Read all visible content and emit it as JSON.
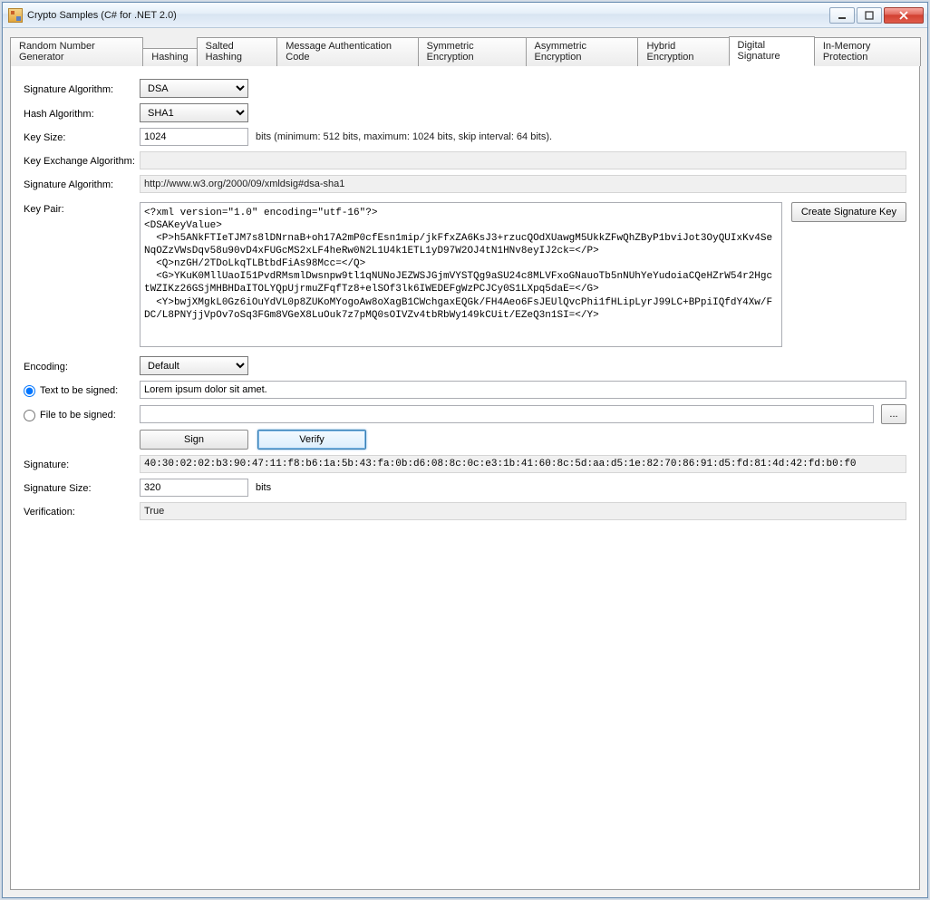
{
  "window": {
    "title": "Crypto Samples (C# for .NET 2.0)"
  },
  "tabs": [
    {
      "label": "Random Number Generator"
    },
    {
      "label": "Hashing"
    },
    {
      "label": "Salted Hashing"
    },
    {
      "label": "Message Authentication Code"
    },
    {
      "label": "Symmetric Encryption"
    },
    {
      "label": "Asymmetric Encryption"
    },
    {
      "label": "Hybrid Encryption"
    },
    {
      "label": "Digital Signature"
    },
    {
      "label": "In-Memory Protection"
    }
  ],
  "labels": {
    "sig_algo": "Signature Algorithm:",
    "hash_algo": "Hash Algorithm:",
    "key_size": "Key Size:",
    "key_exchange": "Key Exchange Algorithm:",
    "sig_algo2": "Signature Algorithm:",
    "key_pair": "Key Pair:",
    "encoding": "Encoding:",
    "text_to_sign": "Text to be signed:",
    "file_to_sign": "File to be signed:",
    "signature": "Signature:",
    "signature_size": "Signature Size:",
    "verification": "Verification:"
  },
  "values": {
    "sig_algo_selected": "DSA",
    "hash_algo_selected": "SHA1",
    "key_size": "1024",
    "key_size_hint": "bits (minimum: 512 bits, maximum: 1024 bits, skip interval: 64 bits).",
    "key_exchange": "",
    "sig_algo_url": "http://www.w3.org/2000/09/xmldsig#dsa-sha1",
    "key_pair_xml": "<?xml version=\"1.0\" encoding=\"utf-16\"?>\n<DSAKeyValue>\n  <P>h5ANkFTIeTJM7s8lDNrnaB+oh17A2mP0cfEsn1mip/jkFfxZA6KsJ3+rzucQOdXUawgM5UkkZFwQhZByP1bviJot3OyQUIxKv4SeNqOZzVWsDqv58u90vD4xFUGcMS2xLF4heRw0N2L1U4k1ETL1yD97W2OJ4tN1HNv8eyIJ2ck=</P>\n  <Q>nzGH/2TDoLkqTLBtbdFiAs98Mcc=</Q>\n  <G>YKuK0MllUaoI51PvdRMsmlDwsnpw9tl1qNUNoJEZWSJGjmVYSTQg9aSU24c8MLVFxoGNauoTb5nNUhYeYudoiaCQeHZrW54r2HgctWZIKz26GSjMHBHDaITOLYQpUjrmuZFqfTz8+elSOf3lk6IWEDEFgWzPCJCy0S1LXpq5daE=</G>\n  <Y>bwjXMgkL0Gz6iOuYdVL0p8ZUKoMYogoAw8oXagB1CWchgaxEQGk/FH4Aeo6FsJEUlQvcPhi1fHLipLyrJ99LC+BPpiIQfdY4Xw/FDC/L8PNYjjVpOv7oSq3FGm8VGeX8LuOuk7z7pMQ0sOIVZv4tbRbWy149kCUit/EZeQ3n1SI=</Y>",
    "encoding_selected": "Default",
    "text_value": "Lorem ipsum dolor sit amet.",
    "file_value": "",
    "signature": "40:30:02:02:b3:90:47:11:f8:b6:1a:5b:43:fa:0b:d6:08:8c:0c:e3:1b:41:60:8c:5d:aa:d5:1e:82:70:86:91:d5:fd:81:4d:42:fd:b0:f0",
    "signature_size": "320",
    "signature_size_unit": "bits",
    "verification": "True"
  },
  "buttons": {
    "create_key": "Create Signature Key",
    "sign": "Sign",
    "verify": "Verify",
    "browse": "..."
  }
}
